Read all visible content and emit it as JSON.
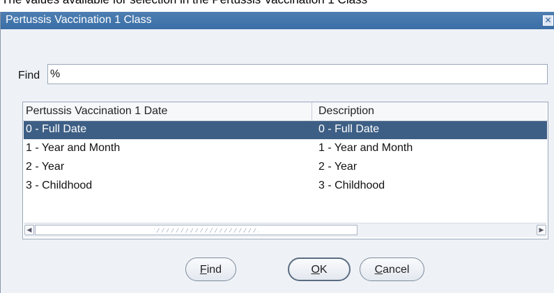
{
  "background_text": "The values available for selection in the Pertussis Vaccination 1 Class",
  "dialog": {
    "title": "Pertussis Vaccination 1 Class",
    "close_glyph": "✕"
  },
  "find": {
    "label": "Find",
    "value": "%"
  },
  "list": {
    "columns": [
      "Pertussis Vaccination 1 Date",
      "Description"
    ],
    "rows": [
      {
        "date": "0 - Full Date",
        "description": "0 - Full Date",
        "selected": true
      },
      {
        "date": "1 - Year and Month",
        "description": "1 - Year and Month",
        "selected": false
      },
      {
        "date": "2 - Year",
        "description": "2 - Year",
        "selected": false
      },
      {
        "date": "3 - Childhood",
        "description": "3 - Childhood",
        "selected": false
      }
    ],
    "scroll_left_glyph": "◀",
    "scroll_right_glyph": "▶"
  },
  "buttons": {
    "find": {
      "mnemonic": "F",
      "rest": "ind"
    },
    "ok": {
      "mnemonic": "O",
      "rest": "K"
    },
    "cancel": {
      "mnemonic": "C",
      "rest": "ancel"
    }
  },
  "colors": {
    "titlebar": "#3a6ea6",
    "selected_row": "#3e5f85",
    "dialog_bg": "#eef2f6"
  }
}
